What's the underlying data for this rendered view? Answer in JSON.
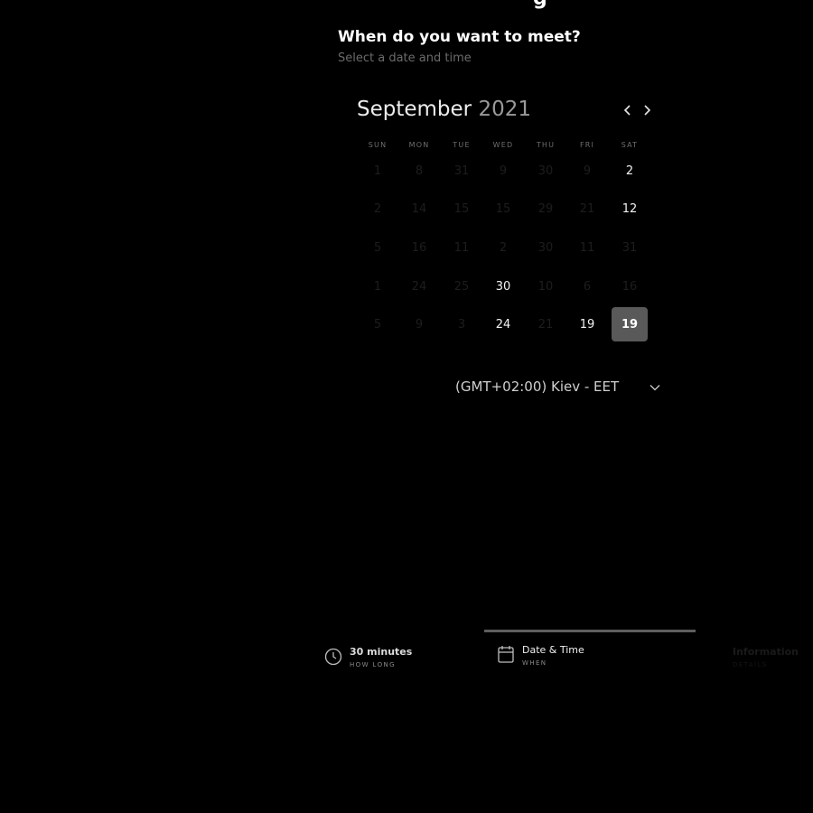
{
  "page": {
    "cut_heading": "g",
    "question_title": "When do you want to meet?",
    "question_subtitle": "Select a date and time"
  },
  "calendar": {
    "month": "September",
    "year": "2021",
    "prev_icon": "chevron-left-icon",
    "next_icon": "chevron-right-icon",
    "weekdays": [
      "SUN",
      "MON",
      "TUE",
      "WED",
      "THU",
      "FRI",
      "SAT"
    ],
    "rows": [
      [
        "1",
        "8",
        "31",
        "9",
        "30",
        "9",
        "2"
      ],
      [
        "2",
        "14",
        "15",
        "15",
        "29",
        "21",
        "12"
      ],
      [
        "5",
        "16",
        "11",
        "2",
        "30",
        "11",
        "31"
      ],
      [
        "1",
        "24",
        "25",
        "30",
        "10",
        "6",
        "16"
      ],
      [
        "5",
        "9",
        "3",
        "24",
        "21",
        "19",
        "19"
      ]
    ],
    "available": [
      [
        false,
        false,
        false,
        false,
        false,
        false,
        true
      ],
      [
        false,
        false,
        false,
        false,
        false,
        false,
        true
      ],
      [
        false,
        false,
        false,
        false,
        false,
        false,
        false
      ],
      [
        false,
        false,
        false,
        true,
        false,
        false,
        false
      ],
      [
        false,
        false,
        false,
        true,
        false,
        true,
        true
      ]
    ],
    "selected": "19"
  },
  "timezone": {
    "label": "(GMT+02:00) Kiev - EET",
    "icon": "chevron-down-icon"
  },
  "steps": [
    {
      "label": "30 minutes",
      "sublabel": "HOW LONG",
      "icon": "clock-icon",
      "state": "done"
    },
    {
      "label": "Date & Time",
      "sublabel": "WHEN",
      "icon": "calendar-icon",
      "state": "active"
    },
    {
      "label": "Information",
      "sublabel": "DETAILS",
      "icon": "",
      "state": "pending"
    }
  ],
  "colors": {
    "background": "#000000",
    "selected_day": "#595959",
    "active_step_bar": "#5e5e5e",
    "muted_text": "#6b6b6b"
  }
}
